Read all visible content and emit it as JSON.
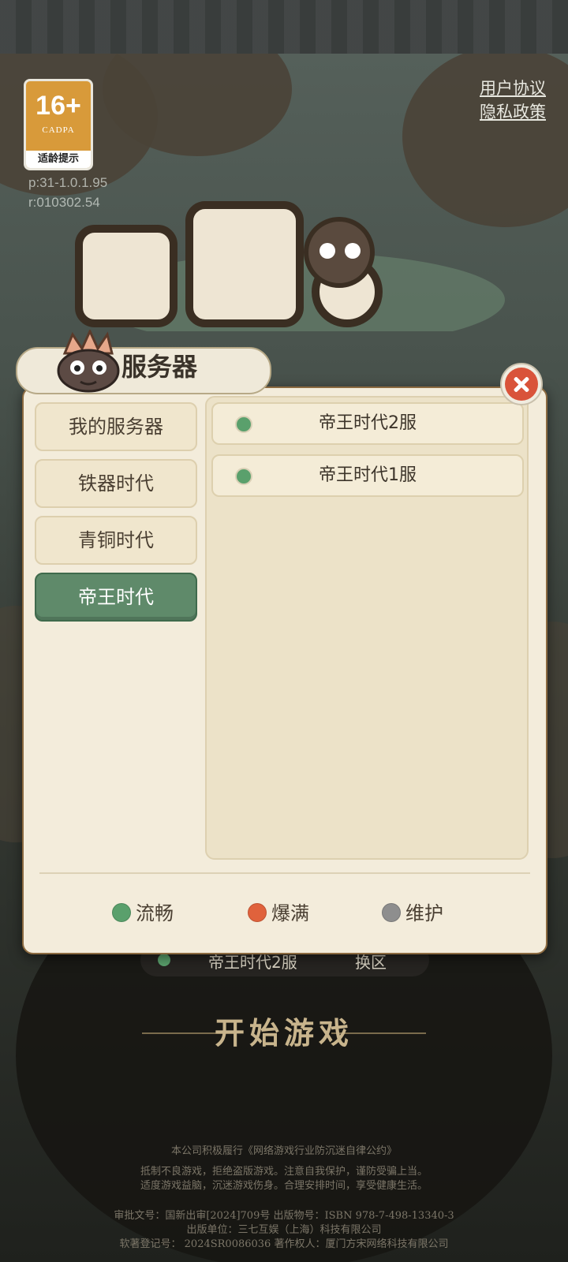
{
  "age_rating": {
    "age": "16+",
    "org": "CADPA",
    "tip": "适龄提示"
  },
  "version": {
    "p": "p:31-1.0.1.95",
    "r": "r:010302.54"
  },
  "links": {
    "user_agreement": "用户协议",
    "privacy_policy": "隐私政策"
  },
  "dialog": {
    "title": "服务器",
    "categories": [
      {
        "label": "我的服务器"
      },
      {
        "label": "铁器时代"
      },
      {
        "label": "青铜时代"
      },
      {
        "label": "帝王时代",
        "selected": true
      }
    ],
    "servers": [
      {
        "name": "帝王时代2服",
        "status": "流畅"
      },
      {
        "name": "帝王时代1服",
        "status": "流畅"
      }
    ],
    "legend": [
      {
        "label": "流畅",
        "color": "#5aa06c"
      },
      {
        "label": "爆满",
        "color": "#e0623c"
      },
      {
        "label": "维护",
        "color": "#8e8e8e"
      }
    ]
  },
  "colors": {
    "smooth": "#5aa06c",
    "full": "#e0623c",
    "maintenance": "#8e8e8e",
    "active_tab": "#5f8a6a",
    "close": "#d9533a"
  },
  "background": {
    "current_server": "帝王时代2服",
    "switch_label": "换区",
    "start_button": "开始游戏"
  },
  "footer": {
    "line1": "本公司积极履行《网络游戏行业防沉迷自律公约》",
    "line2": "抵制不良游戏，拒绝盗版游戏。注意自我保护，谨防受骗上当。",
    "line3": "适度游戏益脑，沉迷游戏伤身。合理安排时间，享受健康生活。",
    "line4": "审批文号：国新出审[2024]709号 出版物号：ISBN 978-7-498-13340-3",
    "line5": "出版单位：三七互娱（上海）科技有限公司",
    "line6": "软著登记号： 2024SR0086036 著作权人：厦门方宋网络科技有限公司"
  }
}
